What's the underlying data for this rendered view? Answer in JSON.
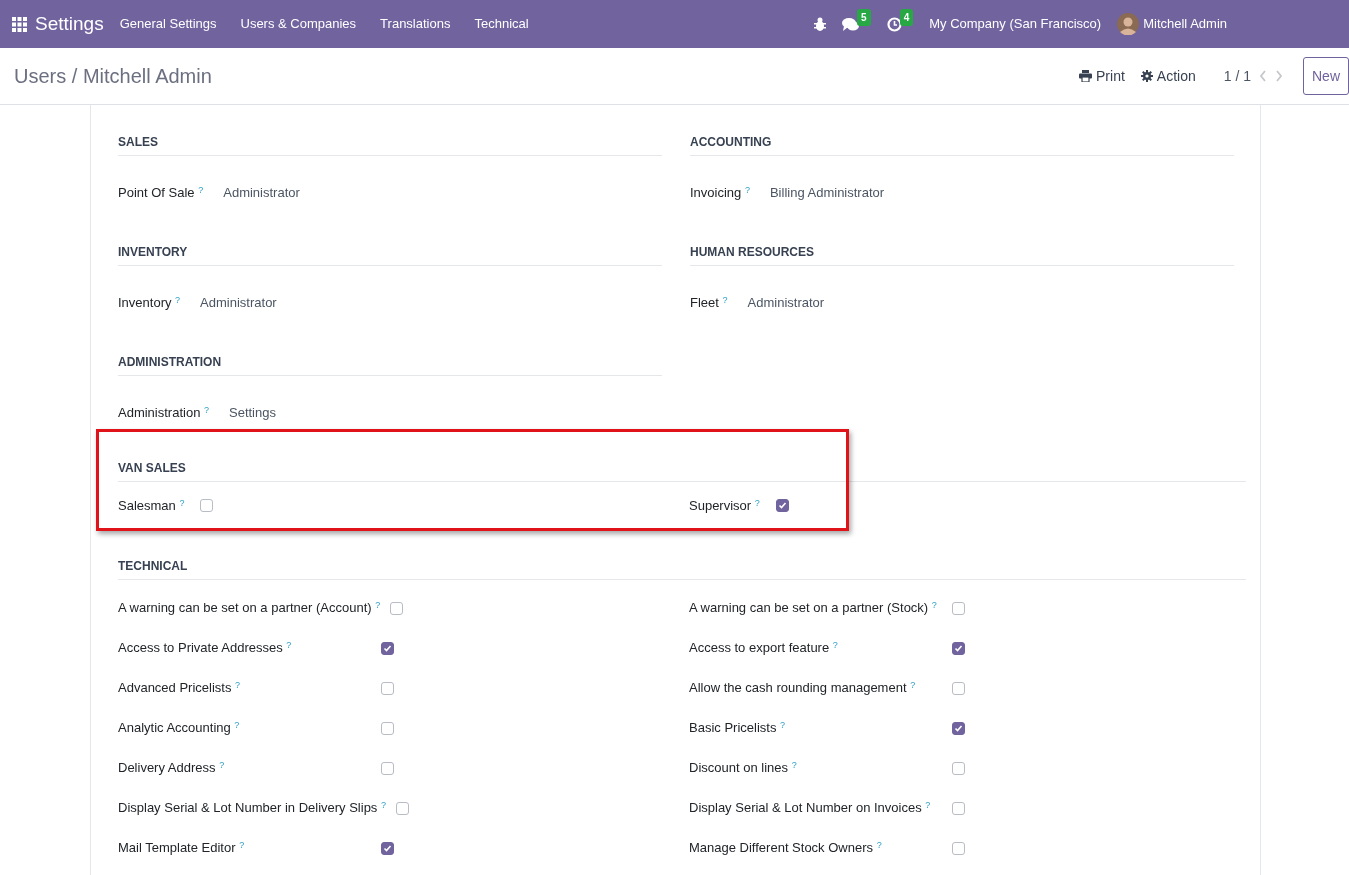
{
  "navbar": {
    "app": "Settings",
    "menu": [
      "General Settings",
      "Users & Companies",
      "Translations",
      "Technical"
    ],
    "messages_count": "5",
    "activities_count": "4",
    "company": "My Company (San Francisco)",
    "user": "Mitchell Admin"
  },
  "breadcrumb": "Users / Mitchell Admin",
  "actions": {
    "print": "Print",
    "action": "Action",
    "pager": "1 / 1",
    "new": "New"
  },
  "group_sections": [
    {
      "title": "SALES",
      "fields": [
        {
          "label": "Point Of Sale",
          "value": "Administrator"
        }
      ]
    },
    {
      "title": "ACCOUNTING",
      "fields": [
        {
          "label": "Invoicing",
          "value": "Billing Administrator"
        }
      ]
    },
    {
      "title": "INVENTORY",
      "fields": [
        {
          "label": "Inventory",
          "value": "Administrator"
        }
      ]
    },
    {
      "title": "HUMAN RESOURCES",
      "fields": [
        {
          "label": "Fleet",
          "value": "Administrator"
        }
      ]
    },
    {
      "title": "ADMINISTRATION",
      "fields": [
        {
          "label": "Administration",
          "value": "Settings"
        }
      ]
    }
  ],
  "van_sales": {
    "title": "VAN SALES",
    "highlight": true,
    "fields": [
      {
        "label": "Salesman",
        "checked": false
      },
      {
        "label": "Supervisor",
        "checked": true
      }
    ]
  },
  "technical": {
    "title": "TECHNICAL",
    "fields": [
      {
        "label": "A warning can be set on a partner (Account)",
        "checked": false
      },
      {
        "label": "A warning can be set on a partner (Stock)",
        "checked": false
      },
      {
        "label": "Access to Private Addresses",
        "checked": true
      },
      {
        "label": "Access to export feature",
        "checked": true
      },
      {
        "label": "Advanced Pricelists",
        "checked": false
      },
      {
        "label": "Allow the cash rounding management",
        "checked": false
      },
      {
        "label": "Analytic Accounting",
        "checked": false
      },
      {
        "label": "Basic Pricelists",
        "checked": true
      },
      {
        "label": "Delivery Address",
        "checked": false
      },
      {
        "label": "Discount on lines",
        "checked": false
      },
      {
        "label": "Display Serial & Lot Number in Delivery Slips",
        "checked": false
      },
      {
        "label": "Display Serial & Lot Number on Invoices",
        "checked": false
      },
      {
        "label": "Mail Template Editor",
        "checked": true
      },
      {
        "label": "Manage Different Stock Owners",
        "checked": false
      }
    ]
  },
  "help_mark": "?"
}
